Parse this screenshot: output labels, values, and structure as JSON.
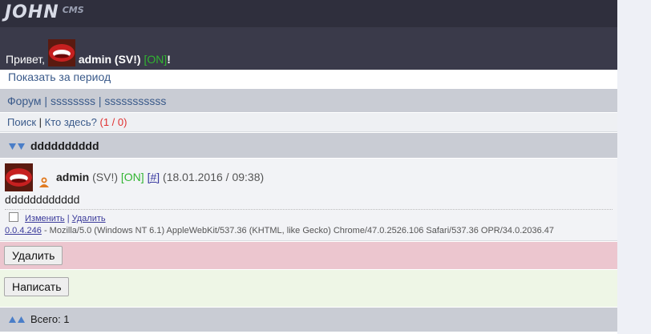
{
  "header": {
    "logo_main": "JOHN",
    "logo_sub": "CMS",
    "greeting": "Привет,",
    "user": "admin (SV!)",
    "status": "[ON]",
    "exclamation": "!"
  },
  "period_link": "Показать за период",
  "breadcrumbs": {
    "forum": "Форум",
    "sep1": "|",
    "section": "ssssssss",
    "sep2": "|",
    "subsection": "sssssssssss"
  },
  "nav": {
    "search": "Поиск",
    "sep": "|",
    "who": "Кто здесь?",
    "count": "(1 / 0)"
  },
  "topic": {
    "title": "dddddddddd"
  },
  "post": {
    "author": "admin",
    "rank": "(SV!)",
    "status": "[ON]",
    "anchor": "[#]",
    "date": "(18.01.2016 / 09:38)",
    "text": "dddddddddddd",
    "edit": "Изменить",
    "tools_sep": "|",
    "delete": "Удалить",
    "ip": "0.0.4.246",
    "user_agent": "- Mozilla/5.0 (Windows NT 6.1) AppleWebKit/537.36 (KHTML, like Gecko) Chrome/47.0.2526.106 Safari/537.36 OPR/34.0.2036.47"
  },
  "buttons": {
    "delete": "Удалить",
    "write": "Написать"
  },
  "footer": {
    "total": "Всего: 1"
  },
  "colors": {
    "header_bg": "#3a3a4a",
    "online": "#31b531",
    "link": "#3a5a8a",
    "delete_bar": "#ecc6cf",
    "write_bar": "#eef6e6"
  },
  "icons": {
    "avatar": "lips-avatar",
    "user_status": "user-online-icon",
    "arrows_down": "double-arrow-down-icon",
    "arrows_up": "double-arrow-up-icon"
  }
}
